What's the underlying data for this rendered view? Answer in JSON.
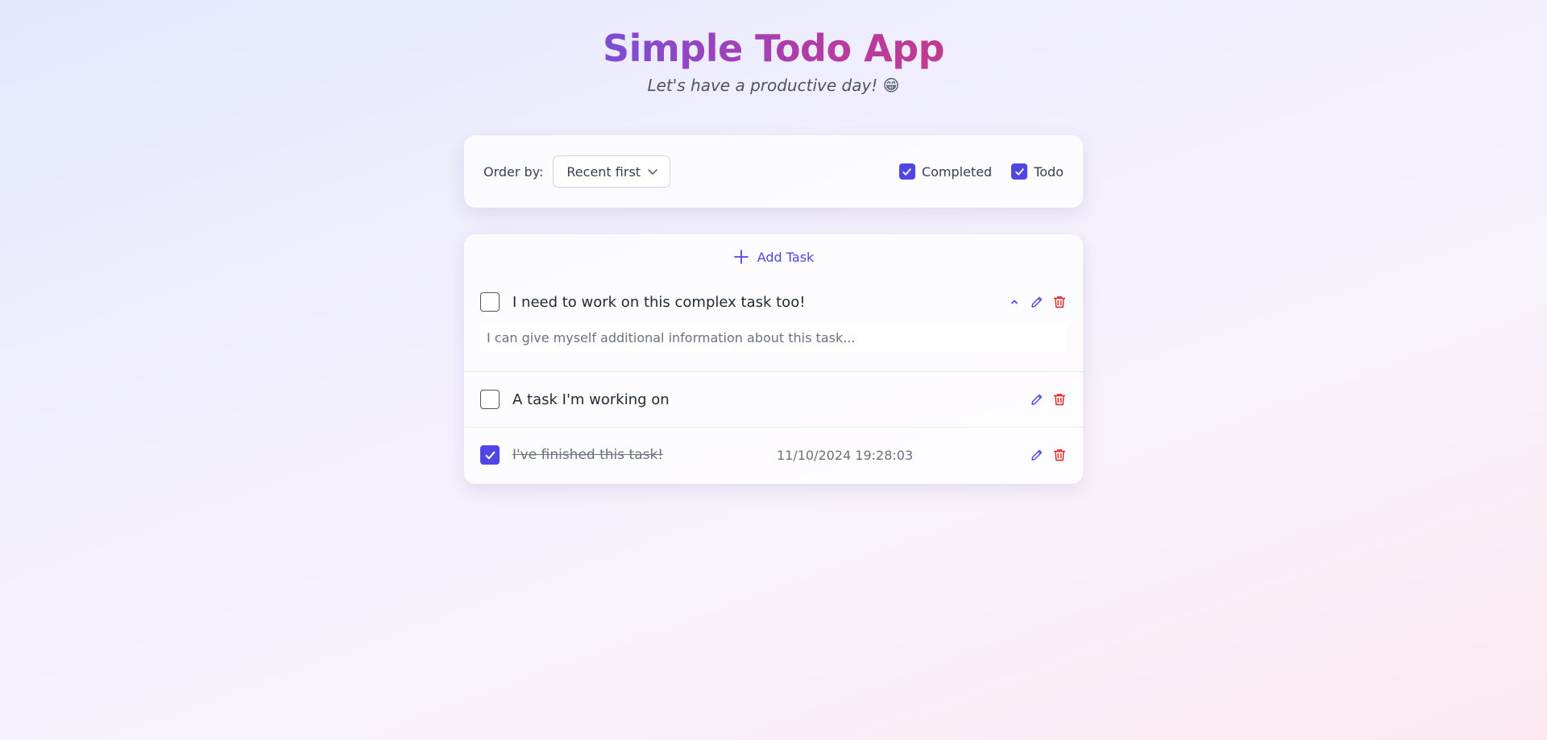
{
  "header": {
    "title": "Simple Todo App",
    "subtitle": "Let's have a productive day! 😁"
  },
  "controls": {
    "order_label": "Order by:",
    "order_value": "Recent first",
    "filters": [
      {
        "label": "Completed",
        "checked": true
      },
      {
        "label": "Todo",
        "checked": true
      }
    ]
  },
  "list": {
    "add_label": "Add Task",
    "tasks": [
      {
        "title": "I need to work on this complex task too!",
        "completed": false,
        "expanded": true,
        "description_placeholder": "I can give myself additional information about this task..."
      },
      {
        "title": "A task I'm working on",
        "completed": false
      },
      {
        "title": "I've finished this task!",
        "completed": true,
        "completed_at": "11/10/2024 19:28:03"
      }
    ]
  },
  "colors": {
    "accent": "#4f46e5",
    "danger": "#dc2626",
    "title_gradient_start": "#7c4dd6",
    "title_gradient_end": "#c23a8f"
  },
  "icons": {
    "select_chevron": "chevron-down-icon",
    "add": "plus-icon",
    "collapse": "chevron-up-icon",
    "edit": "pencil-icon",
    "delete": "trash-icon",
    "checked": "check-icon"
  }
}
